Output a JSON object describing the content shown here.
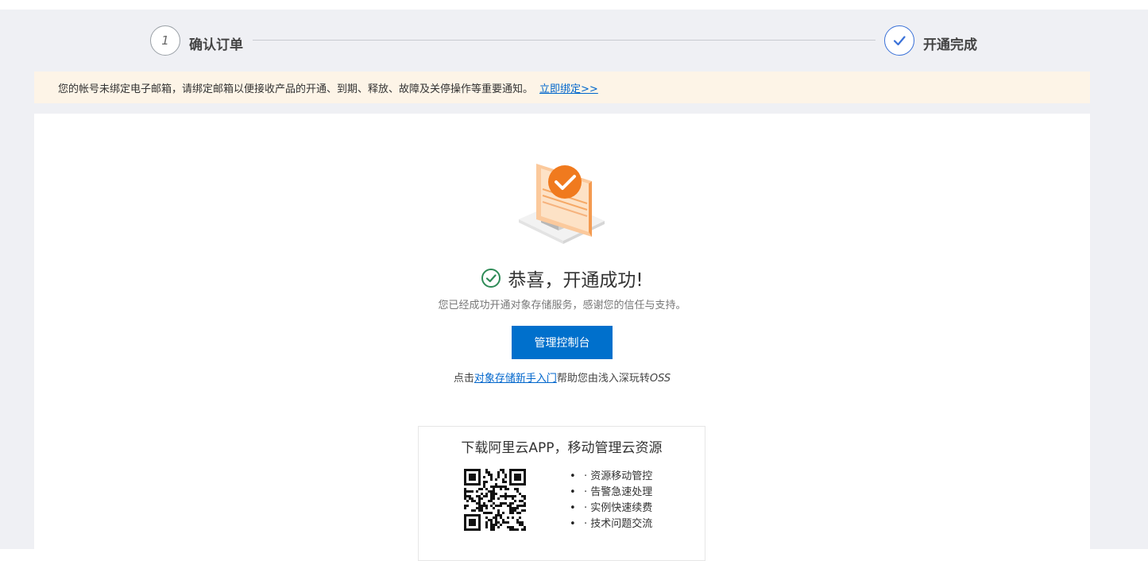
{
  "stepper": {
    "step1": {
      "number": "1",
      "label": "确认订单"
    },
    "step2": {
      "label": "开通完成"
    }
  },
  "notice": {
    "text": "您的帐号未绑定电子邮箱，请绑定邮箱以便接收产品的开通、到期、释放、故障及关停操作等重要通知。",
    "link": "立即绑定>>"
  },
  "result": {
    "title": "恭喜，开通成功!",
    "subtitle": "您已经成功开通对象存储服务，感谢您的信任与支持。",
    "console_button": "管理控制台",
    "guide_prefix": "点击",
    "guide_link": "对象存储新手入门",
    "guide_suffix": "帮助您由浅入深玩转",
    "guide_product": "OSS"
  },
  "app_promo": {
    "title": "下载阿里云APP，移动管理云资源",
    "features": [
      "· 资源移动管控",
      "· 告警急速处理",
      "· 实例快速续费",
      "· 技术问题交流"
    ]
  },
  "colors": {
    "primary": "#0070cc",
    "link": "#0066cc",
    "success": "#2e8b57",
    "accent_orange": "#f07a1e",
    "notice_bg": "#fdf4e7",
    "page_bg": "#eff0f4"
  },
  "icons": {
    "step_done": "check-icon",
    "success": "check-circle-icon",
    "illustration": "monitor-success-illustration",
    "qr": "qr-code-icon"
  }
}
